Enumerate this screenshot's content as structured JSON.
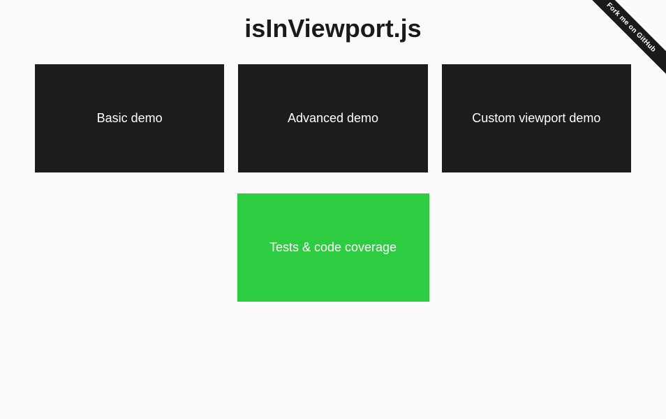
{
  "title": "isInViewport.js",
  "cards": {
    "basic": "Basic demo",
    "advanced": "Advanced demo",
    "custom": "Custom viewport demo",
    "tests": "Tests & code coverage"
  },
  "ribbon": "Fork me on GitHub"
}
